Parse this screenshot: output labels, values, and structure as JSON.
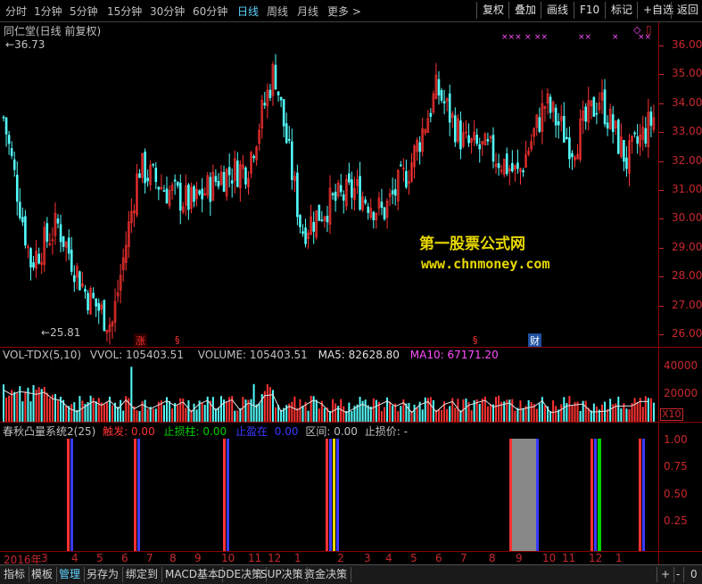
{
  "toolbar": {
    "periods": [
      "分时",
      "1分钟",
      "5分钟",
      "15分钟",
      "30分钟",
      "60分钟",
      "日线",
      "周线",
      "月线",
      "更多 >"
    ],
    "active_period": "日线",
    "buttons": [
      "复权",
      "叠加",
      "画线",
      "F10",
      "标记",
      "+自选",
      "返回"
    ]
  },
  "main_chart": {
    "title": "同仁堂(日线 前复权)",
    "high_label": "36.73",
    "low_label": "25.81",
    "y_ticks": [
      "36.00",
      "35.00",
      "34.00",
      "33.00",
      "32.00",
      "31.00",
      "30.00",
      "29.00",
      "28.00",
      "27.00",
      "26.00"
    ],
    "event_marks": [
      "涨",
      "§",
      "§",
      "财"
    ],
    "top_marks": [
      "×××",
      "×",
      "××",
      "××",
      "×",
      "××"
    ],
    "right_icons": [
      "◇",
      "▯"
    ]
  },
  "watermark": {
    "line1": "第一股票公式网",
    "line2": "www.chnmoney.com"
  },
  "volume_panel": {
    "title": "VOL-TDX(5,10)",
    "vvol": "VVOL: 105403.51",
    "volume": "VOLUME: 105403.51",
    "ma5": "MA5: 82628.80",
    "ma10": "MA10: 67171.20",
    "y_ticks": [
      "40000",
      "20000"
    ],
    "unit": "X10"
  },
  "indicator_panel": {
    "name": "春秋凸量系统2(25)",
    "trigger_label": "触发:",
    "trigger_value": "0.00",
    "stop_column_label": "止损柱:",
    "stop_column_value": "0.00",
    "stop_level_label": "止盈在",
    "stop_level_value": "0.00",
    "interval": "区间: 0.00",
    "stop_price": "止损价: -",
    "y_ticks": [
      "1.00",
      "0.75",
      "0.50",
      "0.25"
    ]
  },
  "x_axis": [
    "2016年",
    "3",
    "4",
    "5",
    "6",
    "7",
    "8",
    "9",
    "10",
    "11",
    "12",
    "1",
    "2",
    "3",
    "4",
    "5",
    "6",
    "7",
    "8",
    "9",
    "10",
    "11",
    "12",
    "1",
    "2"
  ],
  "bottom_tabs": [
    "指标",
    "模板",
    "管理",
    "另存为",
    "绑定到",
    "MACD基本",
    "DDE决策",
    "SUP决策",
    "资金决策"
  ],
  "active_tab": "管理",
  "bottom_right_buttons": [
    "+",
    "-",
    "0"
  ],
  "colors": {
    "up": "#ff3232",
    "down": "#54fcfc",
    "axis": "#c8282d",
    "highlight": "#5fd3ff",
    "watermark": "#e8d800",
    "ma10": "#ff50ff",
    "stop_column": "#00d000",
    "stop_level": "#2020ff"
  },
  "chart_data": [
    {
      "type": "candlestick",
      "title": "同仁堂(日线 前复权)",
      "ylim": [
        25.6,
        36.8
      ],
      "x": [
        "2016-02",
        "2016-03",
        "2016-04",
        "2016-05",
        "2016-06",
        "2016-07",
        "2016-08",
        "2016-09",
        "2016-10",
        "2016-11",
        "2016-12",
        "2017-01",
        "2017-02",
        "2017-03",
        "2017-04",
        "2017-05",
        "2017-06",
        "2017-07",
        "2017-08",
        "2017-09",
        "2017-10",
        "2017-11",
        "2017-12",
        "2018-01",
        "2018-02"
      ],
      "close_approx": [
        33.5,
        28.5,
        29.8,
        27.5,
        26.3,
        31.8,
        31.0,
        30.5,
        31.5,
        31.8,
        35.2,
        29.6,
        30.5,
        31.0,
        30.2,
        31.8,
        34.5,
        32.6,
        32.3,
        31.5,
        34.0,
        32.5,
        34.2,
        32.0,
        33.5
      ],
      "max": 36.73,
      "min": 25.81
    },
    {
      "type": "bar",
      "title": "VOL-TDX(5,10)",
      "ylim": [
        0,
        45000
      ],
      "unit": "X10",
      "latest": {
        "VOLUME": 105403.51,
        "MA5": 82628.8,
        "MA10": 67171.2
      }
    },
    {
      "type": "bar",
      "title": "春秋凸量系统2(25)",
      "ylim": [
        0,
        1.0
      ],
      "signals_month_index": [
        2.8,
        6.8,
        10.8,
        15.3,
        20.3,
        23.7,
        25.1
      ]
    }
  ]
}
